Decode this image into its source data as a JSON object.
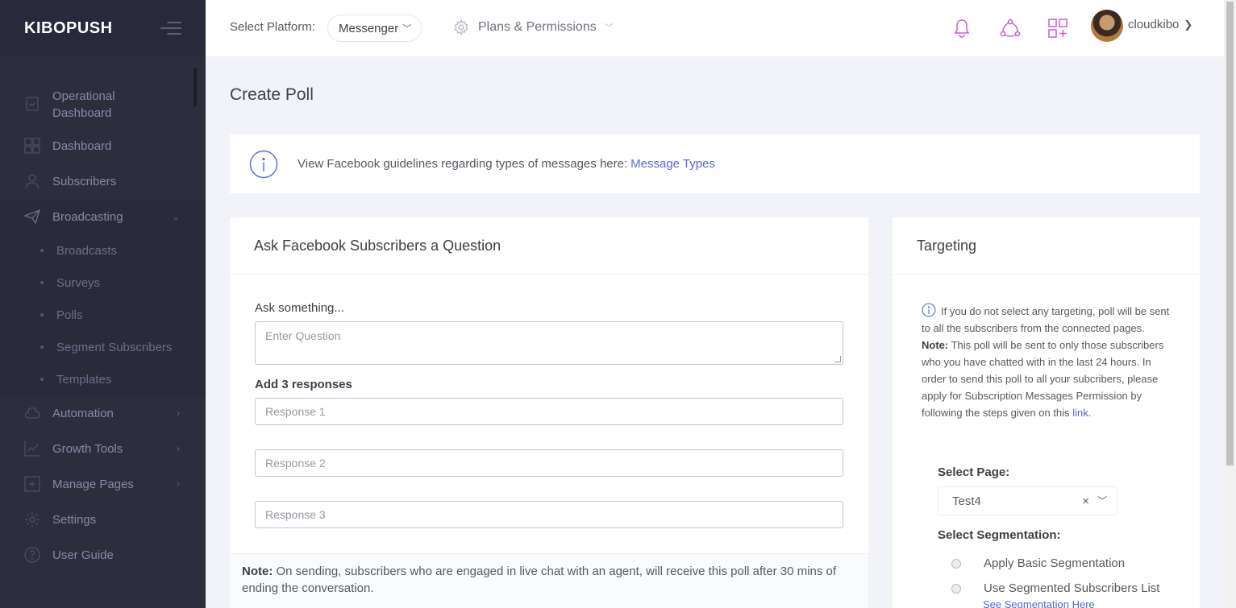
{
  "brand": {
    "name": "KIBOPUSH"
  },
  "sidebar": {
    "items": [
      {
        "label_line1": "Operational",
        "label_line2": "Dashboard",
        "icon": "chart-report-icon"
      },
      {
        "label": "Dashboard",
        "icon": "grid-icon"
      },
      {
        "label": "Subscribers",
        "icon": "user-icon"
      },
      {
        "label": "Broadcasting",
        "icon": "paper-plane-icon"
      },
      {
        "label": "Automation",
        "icon": "cloud-icon"
      },
      {
        "label": "Growth Tools",
        "icon": "line-chart-icon"
      },
      {
        "label": "Manage Pages",
        "icon": "add-page-icon"
      },
      {
        "label": "Settings",
        "icon": "gear-icon"
      },
      {
        "label": "User Guide",
        "icon": "question-icon"
      }
    ],
    "broadcasting_sub": [
      "Broadcasts",
      "Surveys",
      "Polls",
      "Segment Subscribers",
      "Templates"
    ]
  },
  "header": {
    "platform_label": "Select Platform:",
    "platform_value": "Messenger",
    "plans_label": "Plans & Permissions",
    "user_name": "cloudkibo",
    "accent_color": "#c35fcd"
  },
  "page": {
    "title": "Create Poll",
    "alert_text": "View Facebook guidelines regarding types of messages here:",
    "alert_link": "Message Types"
  },
  "poll": {
    "heading": "Ask Facebook Subscribers a Question",
    "question_label": "Ask something...",
    "question_placeholder": "Enter Question",
    "responses_label": "Add 3 responses",
    "responses": [
      "Response 1",
      "Response 2",
      "Response 3"
    ],
    "note_label": "Note:",
    "note_text": "On sending, subscribers who are engaged in live chat with an agent, will receive this poll after 30 mins of ending the conversation."
  },
  "targeting": {
    "heading": "Targeting",
    "info_text": "If you do not select any targeting, poll will be sent to all the subscribers from the connected pages.",
    "note_label": "Note:",
    "note_text": "This poll will be sent to only those subscribers who you have chatted with in the last 24 hours. In order to send this poll to all your subcribers, please apply for Subscription Messages Permission by following the steps given on this",
    "note_link": "link",
    "select_page_label": "Select Page:",
    "select_page_value": "Test4",
    "select_segmentation_label": "Select Segmentation:",
    "options": [
      "Apply Basic Segmentation",
      "Use Segmented Subscribers List"
    ],
    "segmentation_link": "See Segmentation Here"
  }
}
